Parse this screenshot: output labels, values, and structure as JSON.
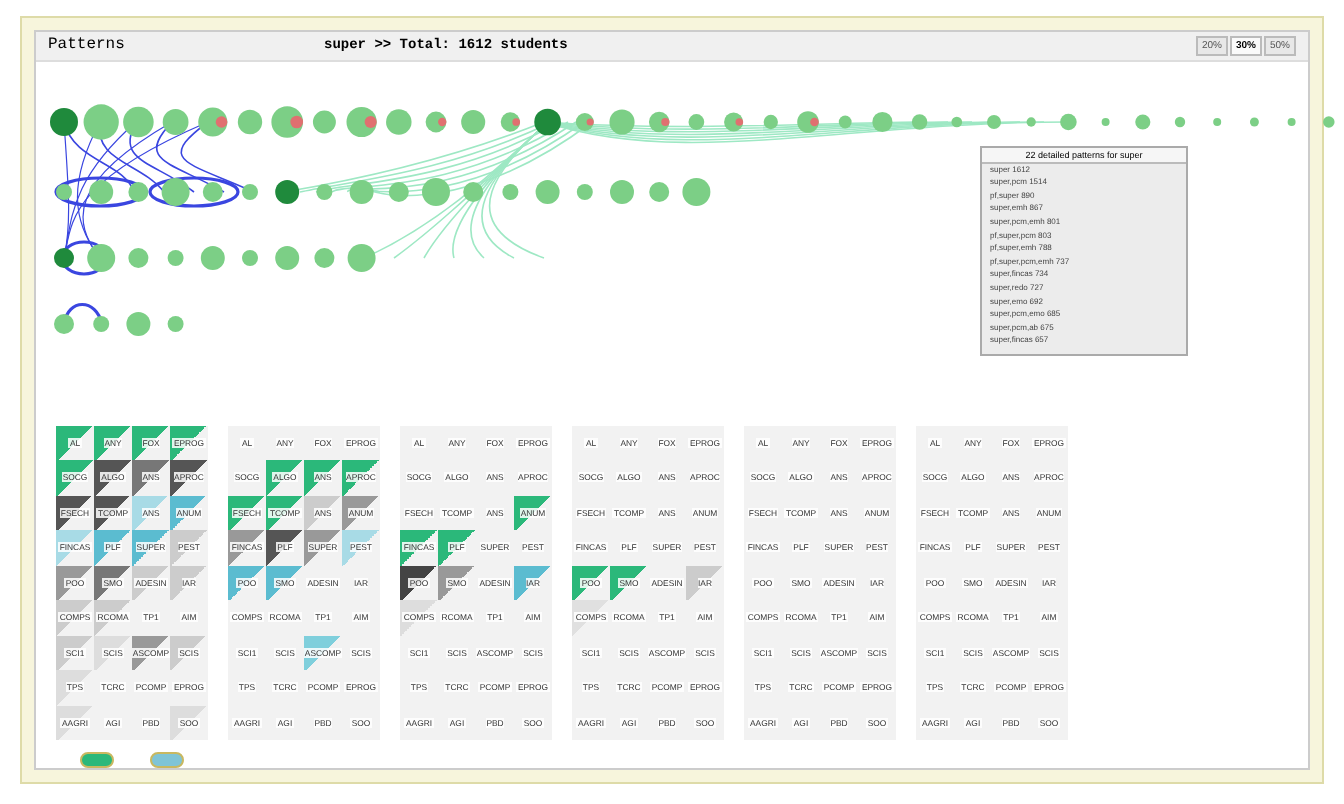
{
  "window": {
    "title": "Patterns"
  },
  "summary": "super >> Total: 1612 students",
  "zoom_buttons": [
    {
      "label": "20%",
      "selected": false
    },
    {
      "label": "30%",
      "selected": true
    },
    {
      "label": "50%",
      "selected": false
    }
  ],
  "popup": {
    "title": "22 detailed patterns for super",
    "items": [
      "super 1612",
      "super,pcm 1514",
      "pf,super 890",
      "super,emh 867",
      "super,pcm,emh 801",
      "pf,super,pcm 803",
      "pf,super,emh 788",
      "pf,super,pcm,emh 737",
      "super,fincas 734",
      "super,redo 727",
      "super,emo 692",
      "super,pcm,emo 685",
      "super,pcm,ab 675",
      "super,fincas 657"
    ]
  },
  "panels": [
    {
      "rows": [
        [
          {
            "label": "AL",
            "color": "#2bb87a"
          },
          {
            "label": "ANY",
            "color": "#2bb87a"
          },
          {
            "label": "FOX",
            "color": "#2bb87a"
          },
          {
            "label": "EPROG",
            "color": "#2bb87a"
          }
        ],
        [
          {
            "label": "SOCG",
            "color": "#2bb87a"
          },
          {
            "label": "ALGO",
            "color": "#555555"
          },
          {
            "label": "ANS",
            "color": "#777777"
          },
          {
            "label": "APROC",
            "color": "#555555"
          }
        ],
        [
          {
            "label": "FSECH",
            "color": "#555555"
          },
          {
            "label": "TCOMP",
            "color": "#555555"
          },
          {
            "label": "ANS",
            "color": "#a8dbe6"
          },
          {
            "label": "ANUM",
            "color": "#5bbcd0"
          }
        ],
        [
          {
            "label": "FINCAS",
            "color": "#a8dbe6"
          },
          {
            "label": "PLF",
            "color": "#5bbcd0"
          },
          {
            "label": "SUPER",
            "color": "#5bbcd0"
          },
          {
            "label": "PEST",
            "color": "#cccccc"
          }
        ],
        [
          {
            "label": "POO",
            "color": "#999999"
          },
          {
            "label": "SMO",
            "color": "#777777"
          },
          {
            "label": "ADESIN",
            "color": "#cccccc"
          },
          {
            "label": "IAR",
            "color": "#cccccc"
          }
        ],
        [
          {
            "label": "COMPS",
            "color": "#cccccc"
          },
          {
            "label": "RCOMA",
            "color": "#cccccc"
          },
          {
            "label": "TP1"
          },
          {
            "label": "AIM"
          }
        ],
        [
          {
            "label": "SCI1",
            "color": "#cccccc"
          },
          {
            "label": "SCIS",
            "color": "#dddddd"
          },
          {
            "label": "ASCOMP",
            "color": "#999999"
          },
          {
            "label": "SCIS",
            "color": "#cccccc"
          }
        ],
        [
          {
            "label": "TPS",
            "color": "#dddddd"
          },
          {
            "label": "TCRC"
          },
          {
            "label": "PCOMP"
          },
          {
            "label": "EPROG"
          }
        ],
        [
          {
            "label": "AAGRI",
            "color": "#dddddd"
          },
          {
            "label": "AGI"
          },
          {
            "label": "PBD"
          },
          {
            "label": "SOO",
            "color": "#dddddd"
          }
        ]
      ]
    },
    {
      "rows": [
        [
          {
            "label": "AL"
          },
          {
            "label": "ANY"
          },
          {
            "label": "FOX"
          },
          {
            "label": "EPROG"
          }
        ],
        [
          {
            "label": "SOCG"
          },
          {
            "label": "ALGO",
            "color": "#2bb87a"
          },
          {
            "label": "ANS",
            "color": "#2bb87a"
          },
          {
            "label": "APROC",
            "color": "#2bb87a"
          }
        ],
        [
          {
            "label": "FSECH",
            "color": "#2bb87a"
          },
          {
            "label": "TCOMP",
            "color": "#2bb87a"
          },
          {
            "label": "ANS",
            "color": "#cccccc"
          },
          {
            "label": "ANUM",
            "color": "#999999"
          }
        ],
        [
          {
            "label": "FINCAS",
            "color": "#999999"
          },
          {
            "label": "PLF",
            "color": "#555555"
          },
          {
            "label": "SUPER",
            "color": "#999999"
          },
          {
            "label": "PEST",
            "color": "#a8dbe6"
          }
        ],
        [
          {
            "label": "POO",
            "color": "#5bbcd0"
          },
          {
            "label": "SMO",
            "color": "#5bbcd0"
          },
          {
            "label": "ADESIN"
          },
          {
            "label": "IAR"
          }
        ],
        [
          {
            "label": "COMPS"
          },
          {
            "label": "RCOMA"
          },
          {
            "label": "TP1"
          },
          {
            "label": "AIM"
          }
        ],
        [
          {
            "label": "SCI1"
          },
          {
            "label": "SCIS"
          },
          {
            "label": "ASCOMP",
            "color": "#7fcfdc"
          },
          {
            "label": "SCIS"
          }
        ],
        [
          {
            "label": "TPS"
          },
          {
            "label": "TCRC"
          },
          {
            "label": "PCOMP"
          },
          {
            "label": "EPROG"
          }
        ],
        [
          {
            "label": "AAGRI"
          },
          {
            "label": "AGI"
          },
          {
            "label": "PBD"
          },
          {
            "label": "SOO"
          }
        ]
      ]
    },
    {
      "rows": [
        [
          {
            "label": "AL"
          },
          {
            "label": "ANY"
          },
          {
            "label": "FOX"
          },
          {
            "label": "EPROG"
          }
        ],
        [
          {
            "label": "SOCG"
          },
          {
            "label": "ALGO"
          },
          {
            "label": "ANS"
          },
          {
            "label": "APROC"
          }
        ],
        [
          {
            "label": "FSECH"
          },
          {
            "label": "TCOMP"
          },
          {
            "label": "ANS"
          },
          {
            "label": "ANUM",
            "color": "#2bb87a"
          }
        ],
        [
          {
            "label": "FINCAS",
            "color": "#2bb87a"
          },
          {
            "label": "PLF",
            "color": "#2bb87a"
          },
          {
            "label": "SUPER"
          },
          {
            "label": "PEST"
          }
        ],
        [
          {
            "label": "POO",
            "color": "#444444"
          },
          {
            "label": "SMO",
            "color": "#999999"
          },
          {
            "label": "ADESIN"
          },
          {
            "label": "IAR",
            "color": "#5bbcd0"
          }
        ],
        [
          {
            "label": "COMPS",
            "color": "#dddddd"
          },
          {
            "label": "RCOMA"
          },
          {
            "label": "TP1"
          },
          {
            "label": "AIM"
          }
        ],
        [
          {
            "label": "SCI1"
          },
          {
            "label": "SCIS"
          },
          {
            "label": "ASCOMP"
          },
          {
            "label": "SCIS"
          }
        ],
        [
          {
            "label": "TPS"
          },
          {
            "label": "TCRC"
          },
          {
            "label": "PCOMP"
          },
          {
            "label": "EPROG"
          }
        ],
        [
          {
            "label": "AAGRI"
          },
          {
            "label": "AGI"
          },
          {
            "label": "PBD"
          },
          {
            "label": "SOO"
          }
        ]
      ]
    },
    {
      "rows": [
        [
          {
            "label": "AL"
          },
          {
            "label": "ANY"
          },
          {
            "label": "FOX"
          },
          {
            "label": "EPROG"
          }
        ],
        [
          {
            "label": "SOCG"
          },
          {
            "label": "ALGO"
          },
          {
            "label": "ANS"
          },
          {
            "label": "APROC"
          }
        ],
        [
          {
            "label": "FSECH"
          },
          {
            "label": "TCOMP"
          },
          {
            "label": "ANS"
          },
          {
            "label": "ANUM"
          }
        ],
        [
          {
            "label": "FINCAS"
          },
          {
            "label": "PLF"
          },
          {
            "label": "SUPER"
          },
          {
            "label": "PEST"
          }
        ],
        [
          {
            "label": "POO",
            "color": "#2bb87a"
          },
          {
            "label": "SMO",
            "color": "#2bb87a"
          },
          {
            "label": "ADESIN"
          },
          {
            "label": "IAR",
            "color": "#cccccc"
          }
        ],
        [
          {
            "label": "COMPS",
            "color": "#e0e0e0"
          },
          {
            "label": "RCOMA"
          },
          {
            "label": "TP1"
          },
          {
            "label": "AIM"
          }
        ],
        [
          {
            "label": "SCI1"
          },
          {
            "label": "SCIS"
          },
          {
            "label": "ASCOMP"
          },
          {
            "label": "SCIS"
          }
        ],
        [
          {
            "label": "TPS"
          },
          {
            "label": "TCRC"
          },
          {
            "label": "PCOMP"
          },
          {
            "label": "EPROG"
          }
        ],
        [
          {
            "label": "AAGRI"
          },
          {
            "label": "AGI"
          },
          {
            "label": "PBD"
          },
          {
            "label": "SOO"
          }
        ]
      ]
    },
    {
      "rows": [
        [
          {
            "label": "AL"
          },
          {
            "label": "ANY"
          },
          {
            "label": "FOX"
          },
          {
            "label": "EPROG"
          }
        ],
        [
          {
            "label": "SOCG"
          },
          {
            "label": "ALGO"
          },
          {
            "label": "ANS"
          },
          {
            "label": "APROC"
          }
        ],
        [
          {
            "label": "FSECH"
          },
          {
            "label": "TCOMP"
          },
          {
            "label": "ANS"
          },
          {
            "label": "ANUM"
          }
        ],
        [
          {
            "label": "FINCAS"
          },
          {
            "label": "PLF"
          },
          {
            "label": "SUPER"
          },
          {
            "label": "PEST"
          }
        ],
        [
          {
            "label": "POO"
          },
          {
            "label": "SMO"
          },
          {
            "label": "ADESIN"
          },
          {
            "label": "IAR"
          }
        ],
        [
          {
            "label": "COMPS"
          },
          {
            "label": "RCOMA"
          },
          {
            "label": "TP1"
          },
          {
            "label": "AIM"
          }
        ],
        [
          {
            "label": "SCI1"
          },
          {
            "label": "SCIS"
          },
          {
            "label": "ASCOMP"
          },
          {
            "label": "SCIS"
          }
        ],
        [
          {
            "label": "TPS"
          },
          {
            "label": "TCRC"
          },
          {
            "label": "PCOMP"
          },
          {
            "label": "EPROG"
          }
        ],
        [
          {
            "label": "AAGRI"
          },
          {
            "label": "AGI"
          },
          {
            "label": "PBD"
          },
          {
            "label": "SOO"
          }
        ]
      ]
    },
    {
      "rows": [
        [
          {
            "label": "AL"
          },
          {
            "label": "ANY"
          },
          {
            "label": "FOX"
          },
          {
            "label": "EPROG"
          }
        ],
        [
          {
            "label": "SOCG"
          },
          {
            "label": "ALGO"
          },
          {
            "label": "ANS"
          },
          {
            "label": "APROC"
          }
        ],
        [
          {
            "label": "FSECH"
          },
          {
            "label": "TCOMP"
          },
          {
            "label": "ANS"
          },
          {
            "label": "ANUM"
          }
        ],
        [
          {
            "label": "FINCAS"
          },
          {
            "label": "PLF"
          },
          {
            "label": "SUPER"
          },
          {
            "label": "PEST"
          }
        ],
        [
          {
            "label": "POO"
          },
          {
            "label": "SMO"
          },
          {
            "label": "ADESIN"
          },
          {
            "label": "IAR"
          }
        ],
        [
          {
            "label": "COMPS"
          },
          {
            "label": "RCOMA"
          },
          {
            "label": "TP1"
          },
          {
            "label": "AIM"
          }
        ],
        [
          {
            "label": "SCI1"
          },
          {
            "label": "SCIS"
          },
          {
            "label": "ASCOMP"
          },
          {
            "label": "SCIS"
          }
        ],
        [
          {
            "label": "TPS"
          },
          {
            "label": "TCRC"
          },
          {
            "label": "PCOMP"
          },
          {
            "label": "EPROG"
          }
        ],
        [
          {
            "label": "AAGRI"
          },
          {
            "label": "AGI"
          },
          {
            "label": "PBD"
          },
          {
            "label": "SOO"
          }
        ]
      ]
    }
  ],
  "buttons": [
    {
      "kind": "green"
    },
    {
      "kind": "blue"
    }
  ]
}
